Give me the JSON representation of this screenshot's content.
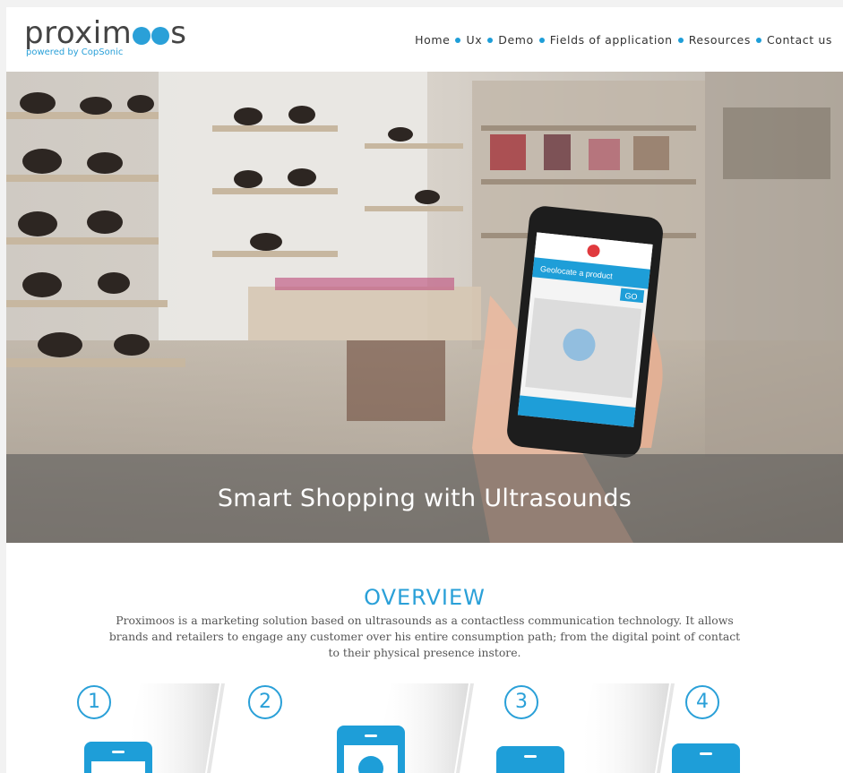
{
  "brand": {
    "name_left": "proxim",
    "name_right": "s",
    "tagline": "powered by CopSonic",
    "accent": "#2aa0d8"
  },
  "nav": {
    "items": [
      {
        "label": "Home"
      },
      {
        "label": "Ux"
      },
      {
        "label": "Demo"
      },
      {
        "label": "Fields of application"
      },
      {
        "label": "Resources"
      },
      {
        "label": "Contact us"
      }
    ]
  },
  "hero": {
    "title": "Smart Shopping with Ultrasounds",
    "phone_screen": {
      "heading": "Geolocate a product",
      "go_label": "GO"
    }
  },
  "overview": {
    "title": "OVERVIEW",
    "text": "Proximoos is a marketing solution based on ultrasounds as a contactless communication technology. It allows brands and retailers to engage any customer over his entire consumption path; from the digital point of contact to their physical presence instore."
  },
  "steps": [
    {
      "number": "1"
    },
    {
      "number": "2"
    },
    {
      "number": "3"
    },
    {
      "number": "4"
    }
  ]
}
